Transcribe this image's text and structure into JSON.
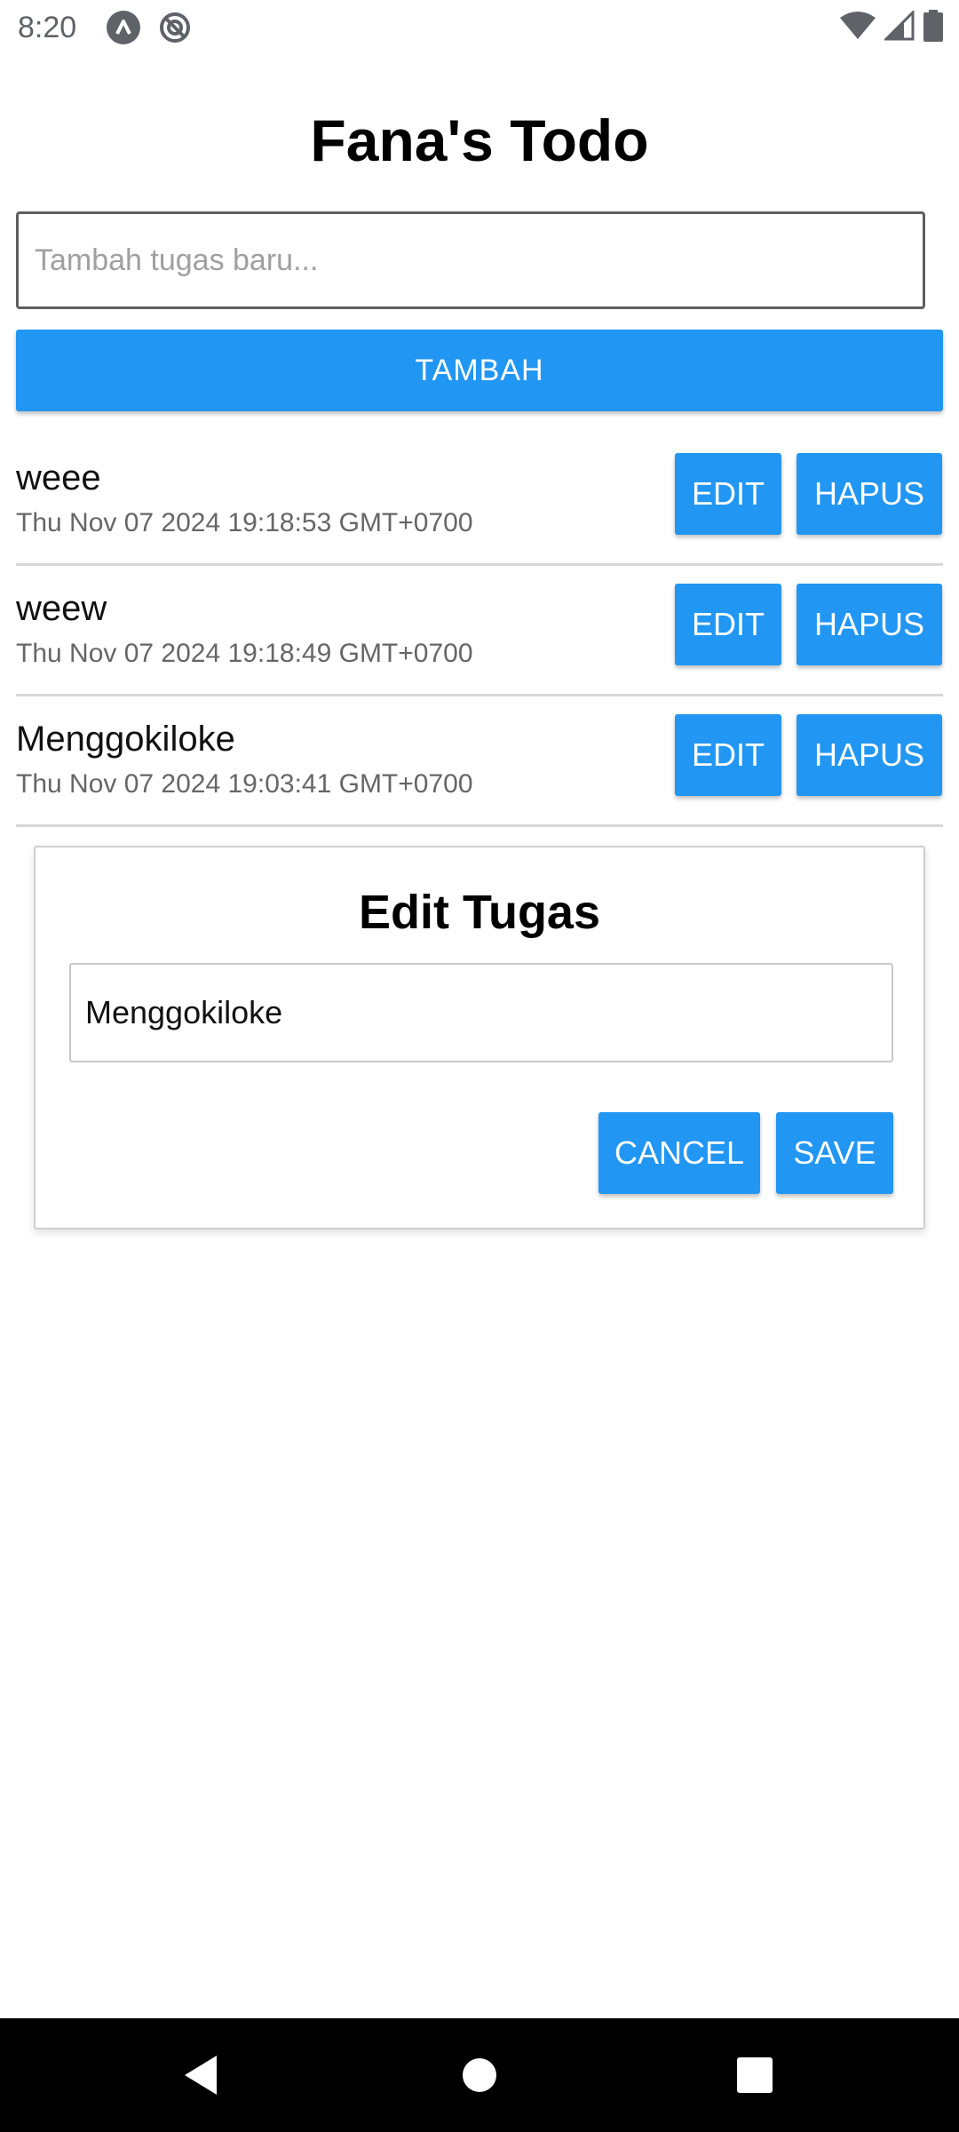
{
  "status_bar": {
    "time": "8:20",
    "left_icons": [
      "app-notification-icon",
      "do-not-disturb-icon"
    ],
    "right_icons": [
      "wifi-icon",
      "cell-signal-icon",
      "battery-icon"
    ]
  },
  "app": {
    "title": "Fana's Todo"
  },
  "new_task": {
    "placeholder": "Tambah tugas baru...",
    "value": "",
    "add_label": "TAMBAH"
  },
  "todos": [
    {
      "title": "weee",
      "date": "Thu Nov 07 2024 19:18:53 GMT+0700",
      "edit_label": "EDIT",
      "delete_label": "HAPUS"
    },
    {
      "title": "weew",
      "date": "Thu Nov 07 2024 19:18:49 GMT+0700",
      "edit_label": "EDIT",
      "delete_label": "HAPUS"
    },
    {
      "title": "Menggokiloke",
      "date": "Thu Nov 07 2024 19:03:41 GMT+0700",
      "edit_label": "EDIT",
      "delete_label": "HAPUS"
    }
  ],
  "edit_dialog": {
    "title": "Edit Tugas",
    "value": "Menggokiloke",
    "cancel_label": "CANCEL",
    "save_label": "SAVE"
  },
  "nav_bar": {
    "icons": [
      "back-icon",
      "home-icon",
      "recents-icon"
    ]
  },
  "colors": {
    "accent": "#2196f3",
    "background": "#ffffff",
    "nav_bar": "#000000"
  }
}
